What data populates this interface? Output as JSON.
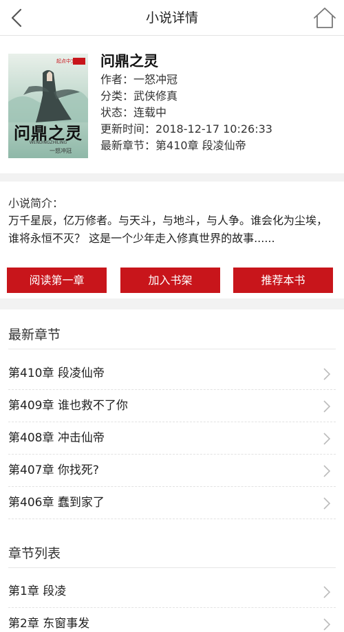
{
  "header": {
    "title": "小说详情",
    "back_icon": "chevron-left-icon",
    "home_icon": "home-icon"
  },
  "book": {
    "title": "问鼎之灵",
    "author_label": "作者：",
    "author": "一怒冲冠",
    "category_label": "分类：",
    "category": "武侠修真",
    "status_label": "状态：",
    "status": "连载中",
    "updated_label": "更新时间：",
    "updated": "2018-12-17 10:26:33",
    "latest_label": "最新章节：",
    "latest": "第410章 段凌仙帝",
    "cover": {
      "publisher": "起点中文网",
      "title": "问鼎之灵",
      "subtitle": "WENDINGZHILING",
      "author": "一怒冲冠"
    }
  },
  "intro": {
    "label": "小说简介：",
    "text": "万千星辰，亿万修者。与天斗，与地斗，与人争。谁会化为尘埃，谁将永恒不灭？ 这是一个少年走入修真世界的故事......"
  },
  "actions": {
    "read_first": "阅读第一章",
    "add_shelf": "加入书架",
    "recommend": "推荐本书"
  },
  "latest": {
    "title": "最新章节",
    "items": [
      "第410章 段凌仙帝",
      "第409章 谁也救不了你",
      "第408章 冲击仙帝",
      "第407章 你找死?",
      "第406章 蠢到家了"
    ]
  },
  "chapters": {
    "title": "章节列表",
    "items": [
      "第1章 段凌",
      "第2章 东窗事发"
    ]
  },
  "colors": {
    "accent": "#c8151b",
    "background": "#f2f2f2"
  }
}
